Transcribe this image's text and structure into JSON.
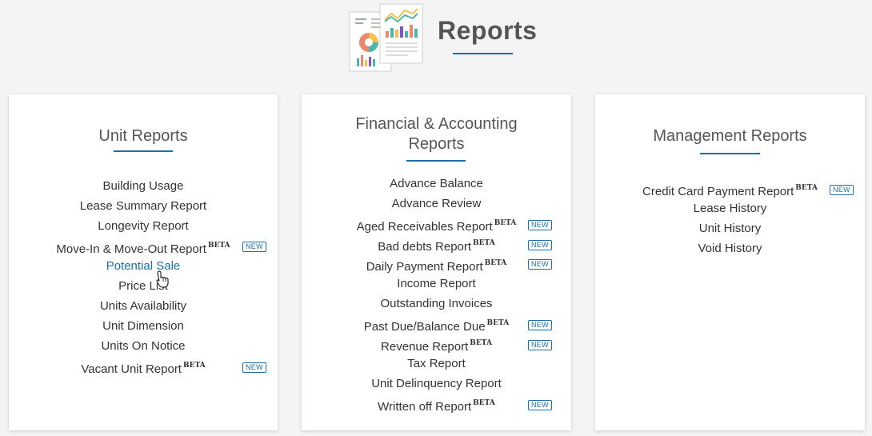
{
  "page": {
    "title": "Reports"
  },
  "unit_reports": {
    "title": "Unit Reports",
    "items": [
      {
        "label": "Building Usage"
      },
      {
        "label": "Lease Summary Report"
      },
      {
        "label": "Longevity Report"
      },
      {
        "label": "Move-In & Move-Out Report",
        "beta": "BETA",
        "badge": "NEW"
      },
      {
        "label": "Potential Sale"
      },
      {
        "label": "Price List"
      },
      {
        "label": "Units Availability"
      },
      {
        "label": "Unit Dimension"
      },
      {
        "label": "Units On Notice"
      },
      {
        "label": "Vacant Unit Report",
        "beta": "BETA",
        "badge": "NEW"
      }
    ]
  },
  "financial_reports": {
    "title_line1": "Financial & Accounting",
    "title_line2": "Reports",
    "items": [
      {
        "label": "Advance Balance"
      },
      {
        "label": "Advance Review"
      },
      {
        "label": "Aged Receivables Report",
        "beta": "BETA",
        "badge": "NEW"
      },
      {
        "label": "Bad debts Report",
        "beta": "BETA",
        "badge": "NEW"
      },
      {
        "label": "Daily Payment Report",
        "beta": "BETA",
        "badge": "NEW"
      },
      {
        "label": "Income Report"
      },
      {
        "label": "Outstanding Invoices"
      },
      {
        "label": "Past Due/Balance Due",
        "beta": "BETA",
        "badge": "NEW"
      },
      {
        "label": "Revenue Report",
        "beta": "BETA",
        "badge": "NEW"
      },
      {
        "label": "Tax Report"
      },
      {
        "label": "Unit Delinquency Report"
      },
      {
        "label": "Written off Report",
        "beta": "BETA",
        "badge": "NEW"
      }
    ]
  },
  "management_reports": {
    "title": "Management Reports",
    "items": [
      {
        "label": "Credit Card Payment Report",
        "beta": "BETA",
        "badge": "NEW"
      },
      {
        "label": "Lease History"
      },
      {
        "label": "Unit History"
      },
      {
        "label": "Void History"
      }
    ]
  },
  "colors": {
    "accent": "#1e6fa8",
    "background": "#f4f4f4",
    "card": "#ffffff"
  }
}
